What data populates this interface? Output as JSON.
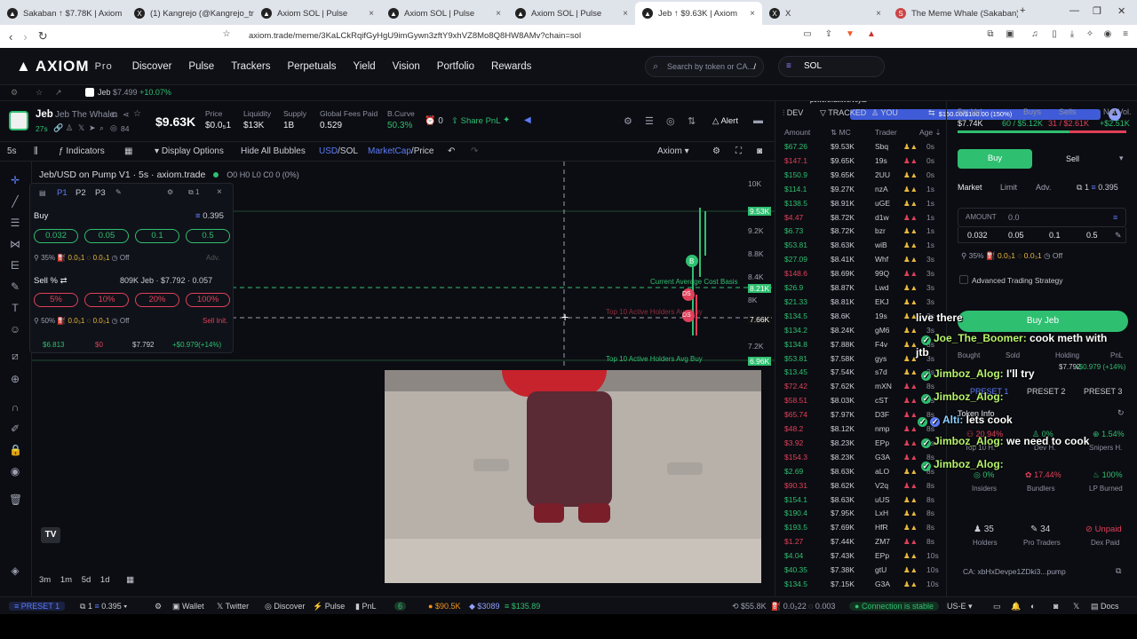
{
  "browser": {
    "tabs": [
      {
        "title": "Sakaban ↑ $7.78K | Axiom",
        "icon": "axiom-icon"
      },
      {
        "title": "(1) Kangrejo (@Kangrejo_trab",
        "icon": "x-icon"
      },
      {
        "title": "Axiom SOL | Pulse",
        "icon": "axiom-icon"
      },
      {
        "title": "Axiom SOL | Pulse",
        "icon": "axiom-icon"
      },
      {
        "title": "Axiom SOL | Pulse",
        "icon": "axiom-icon"
      },
      {
        "title": "Jeb ↑ $9.63K | Axiom",
        "icon": "axiom-icon"
      },
      {
        "title": "X",
        "icon": "x-icon"
      },
      {
        "title": "The Meme Whale (Sakaban) - ",
        "icon": "whale-icon"
      }
    ],
    "url": "axiom.trade/meme/3KaLCkRqifGyHgU9imGywn3zftY9xhVZ8Mo8Q8HW8AMv?chain=sol"
  },
  "app": {
    "logo": "AXIOM",
    "logo_sub": "Pro",
    "nav": [
      "Discover",
      "Pulse",
      "Trackers",
      "Perpetuals",
      "Yield",
      "Vision",
      "Portfolio",
      "Rewards"
    ],
    "search_placeholder": "Search by token or CA...",
    "search_shortcut": "/",
    "chain": "SOL",
    "overlay_url": "powerchat.live/veyta",
    "overlay_goal": "$150.00/$100.00 (150%)"
  },
  "watchlist": {
    "name": "Jeb",
    "price": "$7.499",
    "change": "+10.07%"
  },
  "token": {
    "symbol": "Jeb",
    "name": "Jeb The Whale",
    "age": "27s",
    "holders": "84",
    "mcap": "$9.63K",
    "stats": [
      {
        "label": "Price",
        "value": "$0.0₅1"
      },
      {
        "label": "Liquidity",
        "value": "$13K"
      },
      {
        "label": "Supply",
        "value": "1B"
      },
      {
        "label": "Global Fees Paid",
        "value": "0.529"
      },
      {
        "label": "B.Curve",
        "value": "50.3%"
      }
    ],
    "count": "0",
    "share_pnl": "Share PnL",
    "alert": "Alert"
  },
  "chart_toolbar": {
    "interval": "5s",
    "indicators": "Indicators",
    "display_options": "Display Options",
    "hide_bubbles": "Hide All Bubbles",
    "usd": "USD",
    "sol": "SOL",
    "mcap": "MarketCap",
    "price": "Price",
    "source": "Axiom"
  },
  "chart": {
    "pair_title": "Jeb/USD on Pump V1 · 5s · axiom.trade",
    "ohlc": "O0 H0 L0 C0 0 (0%)",
    "y_labels": [
      "10K",
      "9.53K",
      "9.2K",
      "8.8K",
      "8.4K",
      "8.21K",
      "8K",
      "7.66K",
      "7.2K",
      "6.96K"
    ],
    "lines": {
      "avg_cost": "Current Average Cost Basis",
      "top10_a": "Top 10 Active Holders Avg Buy",
      "top10_b": "Top 10 Active Holders Avg Buy"
    },
    "markers": [
      "B",
      "DS",
      "DS"
    ],
    "timeframes": [
      "3m",
      "1m",
      "5d",
      "1d"
    ]
  },
  "buy_panel": {
    "presets": [
      "P1",
      "P2",
      "P3"
    ],
    "wallets": "1",
    "buy_label": "Buy",
    "balance": "0.395",
    "buy_amounts": [
      "0.032",
      "0.05",
      "0.1",
      "0.5"
    ],
    "buy_slip": "35%",
    "buy_prio": "0.0₃1",
    "buy_bribe": "0.0₃1",
    "auto": "Off",
    "adv": "Adv.",
    "sell_label": "Sell",
    "sell_unit": "%",
    "sell_holding": "809K Jeb · $7.792 · 0.057",
    "sell_amounts": [
      "5%",
      "10%",
      "20%",
      "100%"
    ],
    "sell_slip": "50%",
    "sell_prio": "0.0₃1",
    "sell_bribe": "0.0₃1",
    "sell_init": "Sell Init.",
    "foot": [
      "$6.813",
      "$0",
      "$7.792",
      "+$0.979(+14%)"
    ]
  },
  "trade_feed": {
    "headers": [
      "DEV",
      "TRACKED",
      "YOU"
    ],
    "cols": [
      "Amount",
      "MC",
      "Trader",
      "Age"
    ],
    "rows": [
      {
        "amt": "$67.26",
        "mc": "$9.53K",
        "trader": "Sbq",
        "age": "0s",
        "side": "buy"
      },
      {
        "amt": "$147.1",
        "mc": "$9.65K",
        "trader": "19s",
        "age": "0s",
        "side": "sell"
      },
      {
        "amt": "$150.9",
        "mc": "$9.65K",
        "trader": "2UU",
        "age": "0s",
        "side": "buy"
      },
      {
        "amt": "$114.1",
        "mc": "$9.27K",
        "trader": "nzA",
        "age": "1s",
        "side": "buy"
      },
      {
        "amt": "$138.5",
        "mc": "$8.91K",
        "trader": "uGE",
        "age": "1s",
        "side": "buy"
      },
      {
        "amt": "$4.47",
        "mc": "$8.72K",
        "trader": "d1w",
        "age": "1s",
        "side": "sell"
      },
      {
        "amt": "$6.73",
        "mc": "$8.72K",
        "trader": "bzr",
        "age": "1s",
        "side": "buy"
      },
      {
        "amt": "$53.81",
        "mc": "$8.63K",
        "trader": "wiB",
        "age": "1s",
        "side": "buy"
      },
      {
        "amt": "$27.09",
        "mc": "$8.41K",
        "trader": "Whf",
        "age": "3s",
        "side": "buy"
      },
      {
        "amt": "$148.6",
        "mc": "$8.69K",
        "trader": "99Q",
        "age": "3s",
        "side": "sell"
      },
      {
        "amt": "$26.9",
        "mc": "$8.87K",
        "trader": "Lwd",
        "age": "3s",
        "side": "buy"
      },
      {
        "amt": "$21.33",
        "mc": "$8.81K",
        "trader": "EKJ",
        "age": "3s",
        "side": "buy"
      },
      {
        "amt": "$134.5",
        "mc": "$8.6K",
        "trader": "19s",
        "age": "3s",
        "side": "buy"
      },
      {
        "amt": "$134.2",
        "mc": "$8.24K",
        "trader": "gM6",
        "age": "3s",
        "side": "buy"
      },
      {
        "amt": "$134.8",
        "mc": "$7.88K",
        "trader": "F4v",
        "age": "3s",
        "side": "buy"
      },
      {
        "amt": "$53.81",
        "mc": "$7.58K",
        "trader": "gys",
        "age": "3s",
        "side": "buy"
      },
      {
        "amt": "$13.45",
        "mc": "$7.54K",
        "trader": "s7d",
        "age": "3s",
        "side": "buy"
      },
      {
        "amt": "$72.42",
        "mc": "$7.62K",
        "trader": "mXN",
        "age": "8s",
        "side": "sell"
      },
      {
        "amt": "$58.51",
        "mc": "$8.03K",
        "trader": "cST",
        "age": "8s",
        "side": "sell"
      },
      {
        "amt": "$65.74",
        "mc": "$7.97K",
        "trader": "D3F",
        "age": "8s",
        "side": "sell"
      },
      {
        "amt": "$48.2",
        "mc": "$8.12K",
        "trader": "nmp",
        "age": "8s",
        "side": "sell"
      },
      {
        "amt": "$3.92",
        "mc": "$8.23K",
        "trader": "EPp",
        "age": "8s",
        "side": "sell"
      },
      {
        "amt": "$154.3",
        "mc": "$8.23K",
        "trader": "G3A",
        "age": "8s",
        "side": "sell"
      },
      {
        "amt": "$2.69",
        "mc": "$8.63K",
        "trader": "aLO",
        "age": "8s",
        "side": "buy"
      },
      {
        "amt": "$90.31",
        "mc": "$8.62K",
        "trader": "V2q",
        "age": "8s",
        "side": "sell"
      },
      {
        "amt": "$154.1",
        "mc": "$8.63K",
        "trader": "uUS",
        "age": "8s",
        "side": "buy"
      },
      {
        "amt": "$190.4",
        "mc": "$7.95K",
        "trader": "LxH",
        "age": "8s",
        "side": "buy"
      },
      {
        "amt": "$193.5",
        "mc": "$7.69K",
        "trader": "HfR",
        "age": "8s",
        "side": "buy"
      },
      {
        "amt": "$1.27",
        "mc": "$7.44K",
        "trader": "ZM7",
        "age": "8s",
        "side": "sell"
      },
      {
        "amt": "$4.04",
        "mc": "$7.43K",
        "trader": "EPp",
        "age": "10s",
        "side": "buy"
      },
      {
        "amt": "$40.35",
        "mc": "$7.38K",
        "trader": "gtU",
        "age": "10s",
        "side": "buy"
      },
      {
        "amt": "$134.5",
        "mc": "$7.15K",
        "trader": "G3A",
        "age": "10s",
        "side": "buy"
      }
    ]
  },
  "right": {
    "vol_label": "5m Vol",
    "vol": "$7.74K",
    "buys_label": "Buys",
    "buys": "60 / $5.12K",
    "sells_label": "Sells",
    "sells": "31 / $2.61K",
    "net_label": "Net Vol.",
    "net": "+$2.51K",
    "buy_tab": "Buy",
    "sell_tab": "Sell",
    "order_types": [
      "Market",
      "Limit",
      "Adv."
    ],
    "wallets": "1",
    "balance": "0.395",
    "amount_label": "AMOUNT",
    "amount_value": "0.0",
    "quick": [
      "0.032",
      "0.05",
      "0.1",
      "0.5"
    ],
    "slip": "35%",
    "prio": "0.0₃1",
    "bribe": "0.0₃1",
    "auto": "Off",
    "adv_strategy": "Advanced Trading Strategy",
    "buy_button": "Buy Jeb",
    "pos_labels": [
      "Bought",
      "Sold",
      "Holding",
      "PnL"
    ],
    "holding": "$7.792",
    "pnl": "+$0.979 (+14%)",
    "presets": [
      "PRESET 1",
      "PRESET 2",
      "PRESET 3"
    ],
    "token_info": "Token Info",
    "metrics": [
      {
        "value": "20.94%",
        "label": "Top 10 H.",
        "color": "#e0405a"
      },
      {
        "value": "0%",
        "label": "Dev H.",
        "color": "#2fbf71"
      },
      {
        "value": "1.54%",
        "label": "Snipers H.",
        "color": "#2fbf71"
      },
      {
        "value": "0%",
        "label": "Insiders",
        "color": "#2fbf71"
      },
      {
        "value": "17.44%",
        "label": "Bundlers",
        "color": "#e0405a"
      },
      {
        "value": "100%",
        "label": "LP Burned",
        "color": "#2fbf71"
      },
      {
        "value": "35",
        "label": "Holders",
        "color": "#c9ccd6"
      },
      {
        "value": "34",
        "label": "Pro Traders",
        "color": "#c9ccd6"
      },
      {
        "value": "Unpaid",
        "label": "Dex Paid",
        "color": "#e0405a"
      }
    ],
    "ca": "CA: xbHxDevpe1ZDki3...pump"
  },
  "chat": {
    "lines": [
      {
        "user": "",
        "msg": "live there"
      },
      {
        "user": "Joe_The_Boomer:",
        "msg": "cook meth with"
      },
      {
        "user": "",
        "msg": "jtb"
      },
      {
        "user": "Jimboz_Alog:",
        "msg": "I'll try"
      },
      {
        "user": "Jimboz_Alog:",
        "msg": ""
      },
      {
        "user": "Alti:",
        "msg": "lets cook"
      },
      {
        "user": "Jimboz_Alog:",
        "msg": "we need to cook"
      },
      {
        "user": "Jimboz_Alog:",
        "msg": ""
      }
    ]
  },
  "footer": {
    "preset": "PRESET 1",
    "wallets": "1",
    "balance": "0.395",
    "items": [
      "Wallet",
      "Twitter",
      "Discover",
      "Pulse",
      "PnL"
    ],
    "count": "6",
    "btc": "$90.5K",
    "eth": "$3089",
    "sol": "$135.89",
    "fee1": "$55.8K",
    "fee2": "0.0₂22",
    "fee3": "0.003",
    "connection": "Connection is stable",
    "region": "US-E",
    "docs": "Docs"
  },
  "colors": {
    "green": "#2fbf71",
    "red": "#e0405a",
    "accent": "#5b7cfa",
    "bg": "#0c0d12"
  }
}
